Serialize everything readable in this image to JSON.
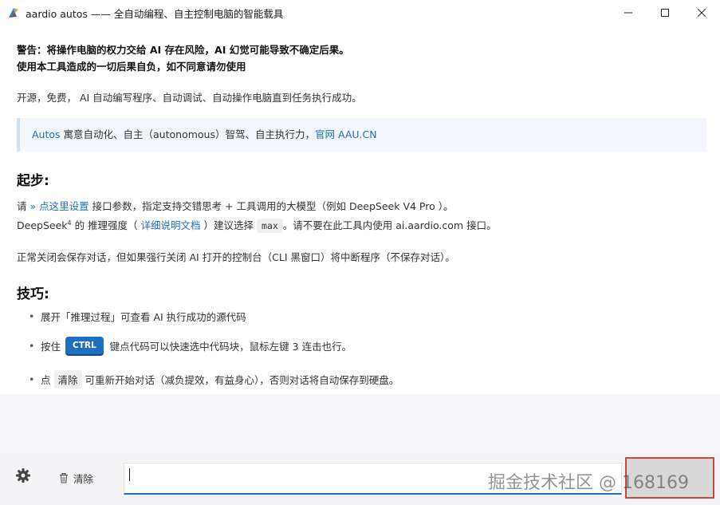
{
  "window": {
    "title": "aardio autos —— 全自动编程、自主控制电脑的智能载具"
  },
  "warning": {
    "line1": "警告：将操作电脑的权力交给 AI 存在风险，AI 幻觉可能导致不确定后果。",
    "line2": "使用本工具造成的一切后果自负，如不同意请勿使用"
  },
  "intro": "开源，免费， AI 自动编写程序、自动调试、自动操作电脑直到任务执行成功。",
  "quote": {
    "brand": "Autos",
    "text": " 寓意自动化、自主（autonomous）智驾、自主执行力，",
    "link": "官网 AAU.CN"
  },
  "start": {
    "heading": "起步:",
    "line1_prefix": "请 ",
    "line1_link": "» 点这里设置",
    "line1_suffix": " 接口参数，指定支持交错思考 + 工具调用的大模型（例如 DeepSeek V4 Pro ）。",
    "line2_prefix": "DeepSeek",
    "line2_sup": "4",
    "line2_mid": " 的 推理强度（ ",
    "line2_link": "详细说明文档",
    "line2_mid2": " ）建议选择 ",
    "line2_code": "max",
    "line2_suffix": "。请不要在此工具内使用 ai.aardio.com 接口。",
    "line3": "正常关闭会保存对话，但如果强行关闭 AI 打开的控制台（CLI 黑窗口）将中断程序（不保存对话）。"
  },
  "tips": {
    "heading": "技巧:",
    "tip1": "展开「推理过程」可查看 AI 执行成功的源代码",
    "tip2_prefix": "按住",
    "tip2_key": "CTRL",
    "tip2_suffix": "键点代码可以快速选中代码块，鼠标左键 3 连击也行。",
    "tip3_prefix": "点",
    "tip3_chip": "清除",
    "tip3_suffix": "可重新开始对话（减负提效，有益身心），否则对话将自动保存到硬盘。"
  },
  "bottombar": {
    "clear_label": "清除",
    "input_value": "",
    "watermark": "掘金技术社区 @ 168169"
  },
  "colors": {
    "accent": "#1f6fbf",
    "highlight_border": "#c9473a"
  }
}
